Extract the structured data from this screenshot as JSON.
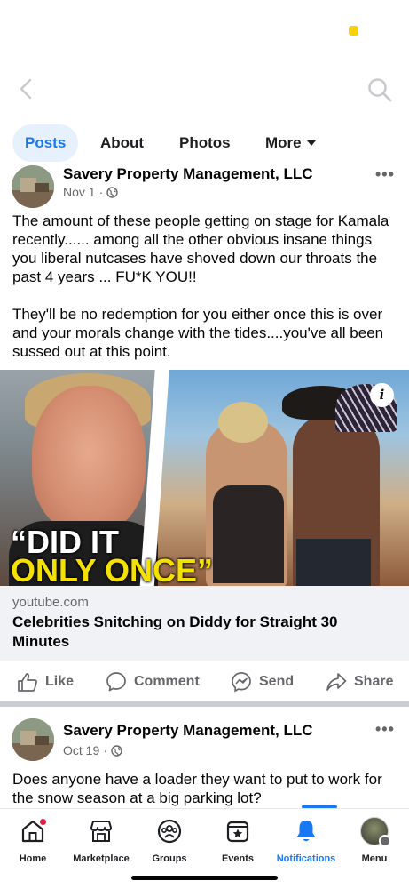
{
  "tabs": [
    {
      "label": "Posts",
      "active": true
    },
    {
      "label": "About"
    },
    {
      "label": "Photos"
    },
    {
      "label": "More"
    }
  ],
  "posts": [
    {
      "author": "Savery Property Management, LLC",
      "date": "Nov 1",
      "privacy_icon": "globe-icon",
      "text": "The amount of these people getting on stage for Kamala recently...... among all the other obvious insane things you liberal nutcases have shoved down our throats the past 4 years ... FU*K YOU!!\n\nThey'll be no redemption for you either once this is over and your morals change with the tides....you've all been sussed out at this point.",
      "link": {
        "image_caption_line1": "“DID IT",
        "image_caption_line2": "ONLY ONCE”",
        "domain": "youtube.com",
        "title": "Celebrities Snitching on Diddy for Straight 30 Minutes"
      }
    },
    {
      "author": "Savery Property Management, LLC",
      "date": "Oct 19",
      "privacy_icon": "globe-icon",
      "text": "Does anyone have a loader they want to put to work for the snow season at a big parking lot?"
    }
  ],
  "post_actions": {
    "like": "Like",
    "comment": "Comment",
    "send": "Send",
    "share": "Share"
  },
  "tabbar": [
    {
      "label": "Home",
      "icon": "home-icon",
      "notification_dot": true
    },
    {
      "label": "Marketplace",
      "icon": "marketplace-icon"
    },
    {
      "label": "Groups",
      "icon": "groups-icon"
    },
    {
      "label": "Events",
      "icon": "events-icon"
    },
    {
      "label": "Notifications",
      "icon": "bell-icon",
      "active": true
    },
    {
      "label": "Menu",
      "icon": "profile-avatar"
    }
  ],
  "colors": {
    "accent": "#1877f2",
    "active_tab_bg": "#e7f1fd",
    "notification_dot": "#e41e3f",
    "headline_yellow": "#f5e100"
  }
}
